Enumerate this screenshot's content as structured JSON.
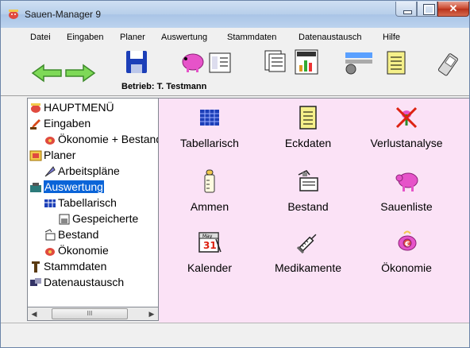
{
  "window": {
    "title": "Sauen-Manager 9",
    "close_glyph": "✕"
  },
  "menu": [
    "Datei",
    "Eingaben",
    "Planer",
    "Auswertung",
    "Stammdaten",
    "Datenaustausch",
    "Hilfe"
  ],
  "toolbar": {
    "betrieb_label": "Betrieb: T. Testmann",
    "icons": [
      "back-arrow-icon",
      "forward-arrow-icon",
      "save-icon",
      "pig-icon",
      "list-icon",
      "report-icon",
      "status-chart-icon",
      "machine-icon",
      "notes-icon",
      "pda-icon"
    ]
  },
  "tree": {
    "items": [
      {
        "label": "HAUPTMENÜ",
        "icon": "pig-icon"
      },
      {
        "label": "Eingaben",
        "icon": "pen-icon"
      },
      {
        "label": "Ökonomie + Bestand",
        "icon": "pig-money-icon"
      },
      {
        "label": "Planer",
        "icon": "planner-icon"
      },
      {
        "label": "Arbeitspläne",
        "icon": "feather-icon"
      },
      {
        "label": "Auswertung",
        "icon": "evaluation-icon"
      },
      {
        "label": "Tabellarisch",
        "icon": "table-icon"
      },
      {
        "label": "Gespeicherte",
        "icon": "saved-icon"
      },
      {
        "label": "Bestand",
        "icon": "inventory-icon"
      },
      {
        "label": "Ökonomie",
        "icon": "pig-money-icon"
      },
      {
        "label": "Stammdaten",
        "icon": "master-data-icon"
      },
      {
        "label": "Datenaustausch",
        "icon": "exchange-icon"
      }
    ],
    "scroll_thumb_glyph": "III"
  },
  "grid": [
    {
      "label": "Tabellarisch",
      "icon": "table-icon"
    },
    {
      "label": "Eckdaten",
      "icon": "notepad-icon"
    },
    {
      "label": "Verlustanalyse",
      "icon": "loss-analysis-icon"
    },
    {
      "label": "Ammen",
      "icon": "baby-bottle-icon"
    },
    {
      "label": "Bestand",
      "icon": "inventory-icon"
    },
    {
      "label": "Sauenliste",
      "icon": "pig-icon"
    },
    {
      "label": "Kalender",
      "icon": "calendar-icon"
    },
    {
      "label": "Medikamente",
      "icon": "syringe-icon"
    },
    {
      "label": "Ökonomie",
      "icon": "pig-money-icon"
    }
  ],
  "calendar": {
    "month": "May",
    "day": "31"
  },
  "colors": {
    "content_bg": "#fbe2f6",
    "selection": "#0a64d8",
    "pig_pink": "#e653c9"
  }
}
